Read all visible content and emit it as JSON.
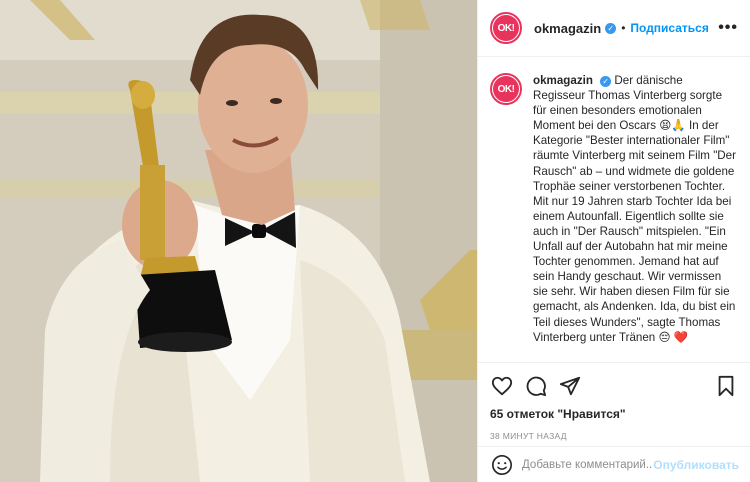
{
  "account": {
    "username": "okmagazin",
    "avatar_text": "OK!",
    "follow_label": "Подписаться",
    "separator": "•",
    "more_label": "•••"
  },
  "caption": {
    "username": "okmagazin",
    "text": "Der dänische Regisseur Thomas Vinterberg sorgte für einen besonders emotionalen Moment bei den Oscars 😫🙏 In der Kategorie \"Bester internationaler Film\" räumte Vinterberg mit seinem Film \"Der Rausch\" ab – und widmete die goldene Trophäe seiner verstorbenen Tochter. Mit nur 19 Jahren starb Tochter Ida bei einem Autounfall. Eigentlich sollte sie auch in \"Der Rausch\" mitspielen. \"Ein Unfall auf der Autobahn hat mir meine Tochter genommen. Jemand hat auf sein Handy geschaut. Wir vermissen sie sehr. Wir haben diesen Film für sie gemacht, als Andenken. Ida, du bist ein Teil dieses Wunders\", sagte Thomas Vinterberg unter Tränen 😔 ❤️"
  },
  "actions": {
    "icons": [
      "heart-icon",
      "comment-icon",
      "share-icon",
      "bookmark-icon"
    ],
    "likes": "65 отметок \"Нравится\"",
    "time": "38 минут назад"
  },
  "comment": {
    "placeholder": "Добавьте комментарий...",
    "publish_label": "Опубликовать"
  },
  "colors": {
    "brand": "#e8335d",
    "link": "#0095f6",
    "publish_disabled": "#b2dffc"
  }
}
